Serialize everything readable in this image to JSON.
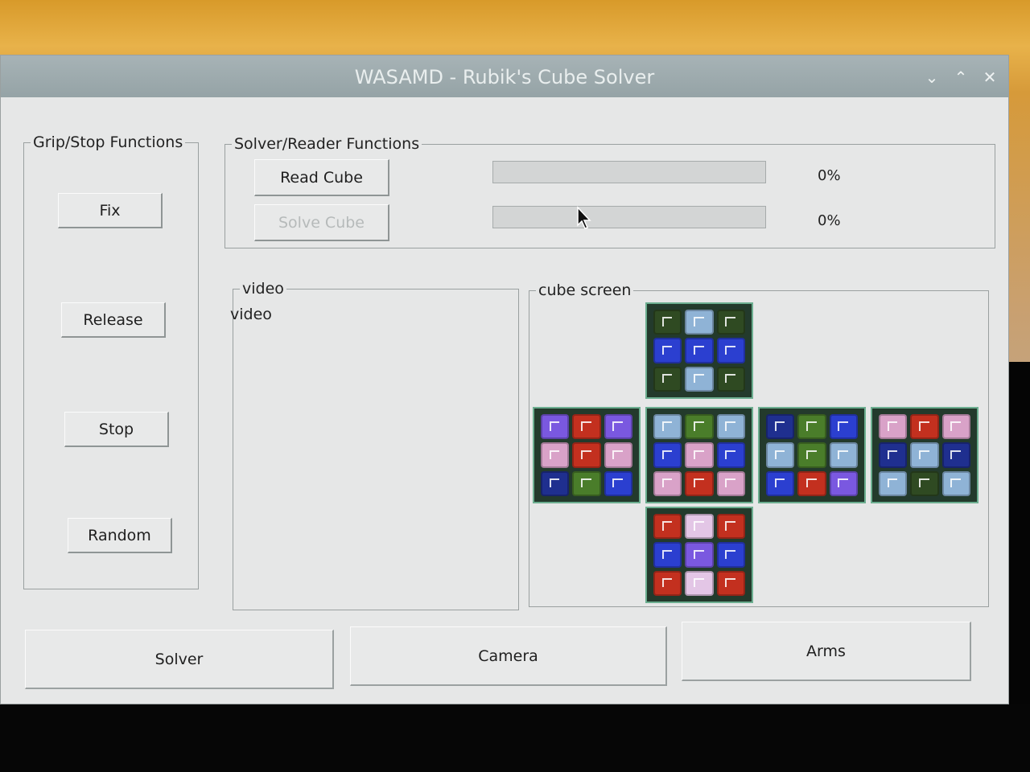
{
  "window": {
    "title": "WASAMD - Rubik's Cube Solver"
  },
  "titlebar_controls": {
    "minimize": "⌄",
    "maximize": "⌃",
    "close": "✕"
  },
  "grip_frame": {
    "label": "Grip/Stop Functions",
    "buttons": {
      "fix": "Fix",
      "release": "Release",
      "stop": "Stop",
      "random": "Random"
    }
  },
  "solver_frame": {
    "label": "Solver/Reader Functions",
    "read_button": "Read Cube",
    "solve_button": "Solve Cube",
    "read_progress": {
      "value": 0,
      "text": "0%"
    },
    "solve_progress": {
      "value": 0,
      "text": "0%"
    }
  },
  "video_frame": {
    "label": "video",
    "placeholder": "video"
  },
  "cube_frame": {
    "label": "cube screen"
  },
  "cube_colors": {
    "G": "#2f4a22",
    "g": "#4a7d2a",
    "L": "#8fb3d6",
    "B": "#2b3fd0",
    "P": "#d9a2c8",
    "R": "#c3301f",
    "V": "#7a58e0",
    "W": "#e3c6e6",
    "N": "#1f2f8f"
  },
  "cube_faces": {
    "up": [
      "G",
      "L",
      "G",
      "B",
      "B",
      "B",
      "G",
      "L",
      "G"
    ],
    "left": [
      "V",
      "R",
      "V",
      "P",
      "R",
      "P",
      "N",
      "g",
      "B"
    ],
    "front": [
      "L",
      "g",
      "L",
      "B",
      "P",
      "B",
      "P",
      "R",
      "P"
    ],
    "right": [
      "N",
      "g",
      "B",
      "L",
      "g",
      "L",
      "B",
      "R",
      "V"
    ],
    "back": [
      "P",
      "R",
      "P",
      "N",
      "L",
      "N",
      "L",
      "G",
      "L"
    ],
    "down": [
      "R",
      "W",
      "R",
      "B",
      "V",
      "B",
      "R",
      "W",
      "R"
    ]
  },
  "tabs": {
    "solver": "Solver",
    "camera": "Camera",
    "arms": "Arms"
  }
}
